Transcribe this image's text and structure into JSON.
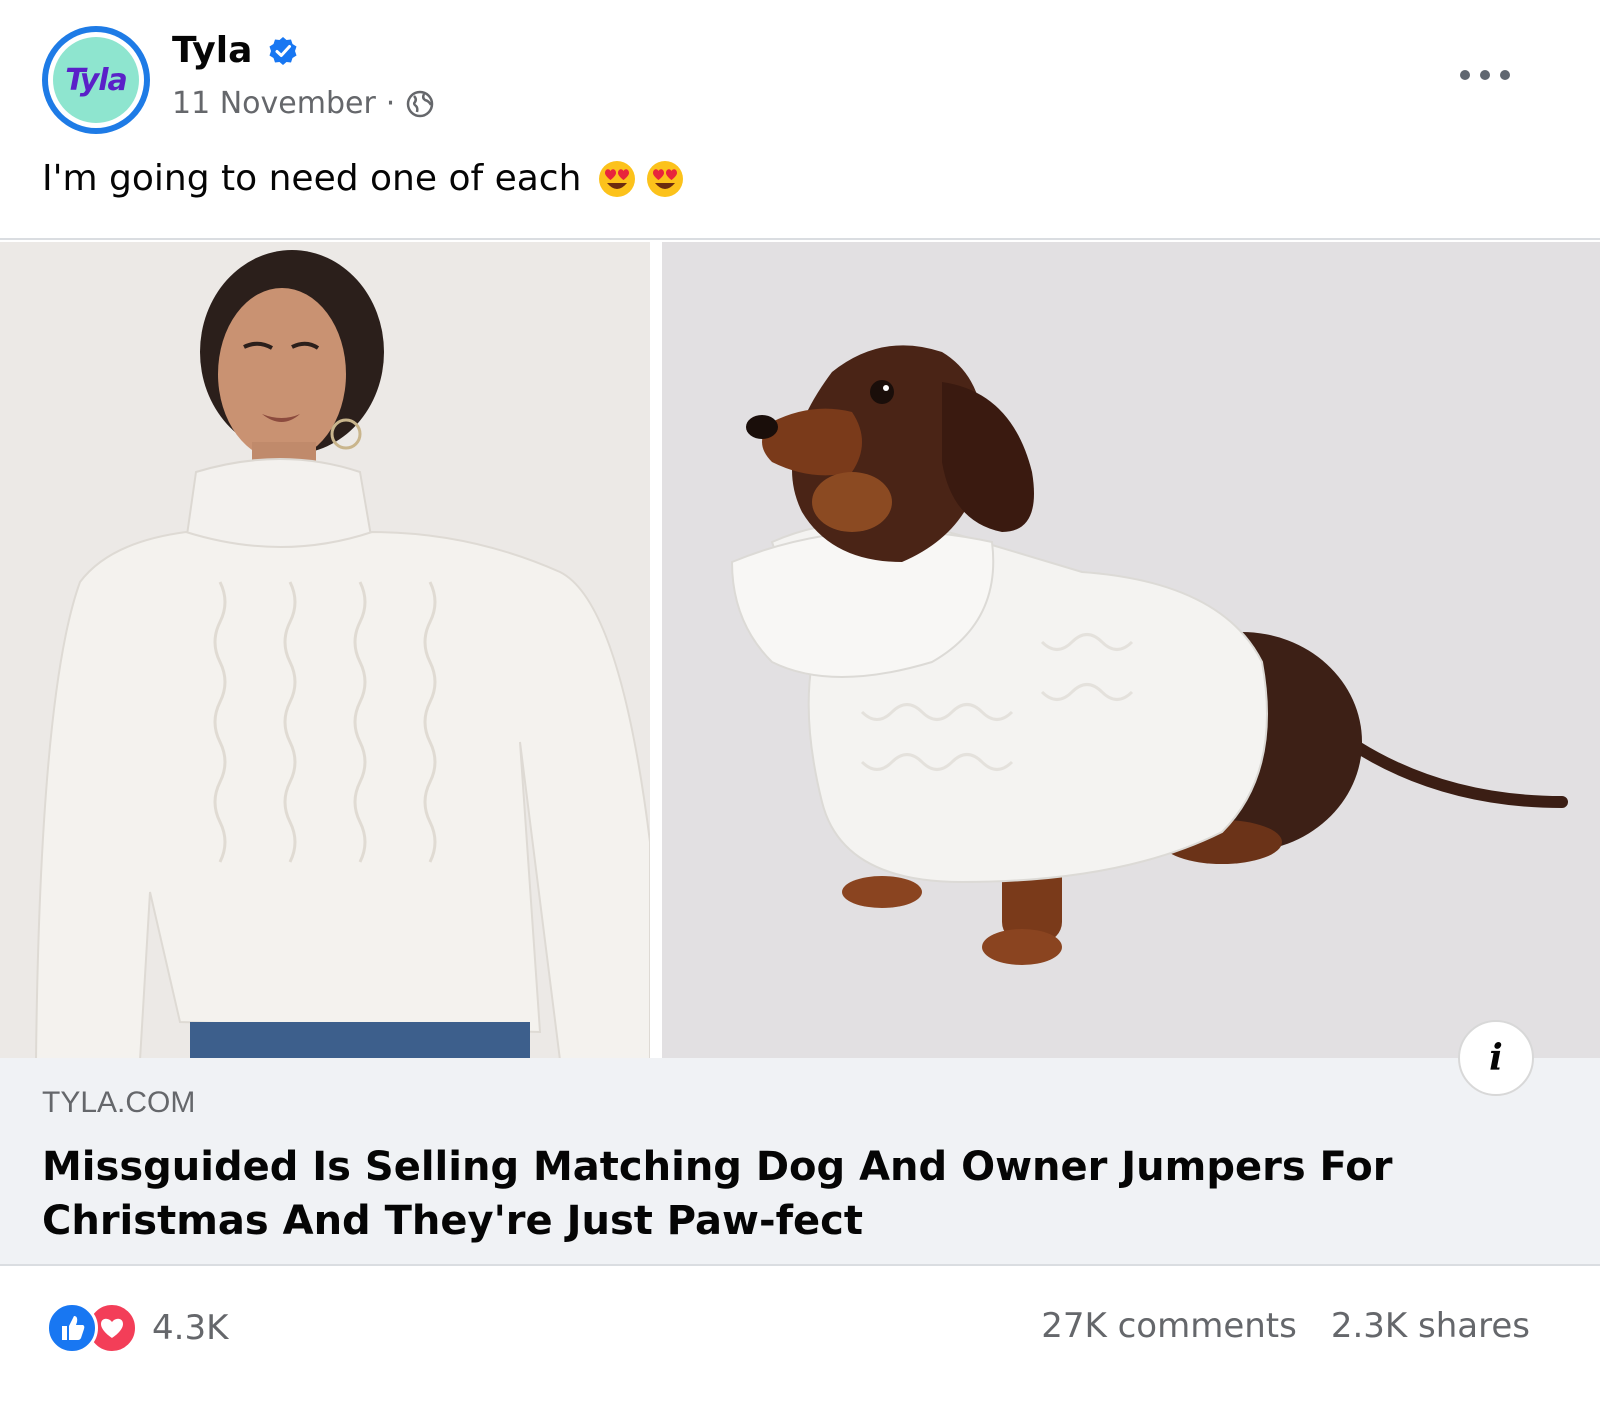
{
  "post": {
    "page_name": "Tyla",
    "avatar_logo_text": "Tyla",
    "date": "11 November",
    "separator": "·",
    "caption": "I'm going to need one of each"
  },
  "link_preview": {
    "domain": "TYLA.COM",
    "headline": "Missguided Is Selling Matching Dog And Owner Jumpers For Christmas And They're Just Paw-fect",
    "info_icon_text": "i"
  },
  "engagement": {
    "reaction_count": "4.3K",
    "comments": "27K comments",
    "shares": "2.3K shares"
  },
  "icons": {
    "verified": "verified-badge-icon",
    "audience": "globe-icon",
    "more": "more-options-icon",
    "emoji": "heart-eyes-emoji-icon",
    "like": "like-reaction-icon",
    "love": "love-reaction-icon"
  },
  "colors": {
    "text_primary": "#050505",
    "text_secondary": "#65676b",
    "link_box_bg": "#f0f2f5",
    "verified_blue": "#1877f2",
    "love_red": "#f33e58"
  }
}
